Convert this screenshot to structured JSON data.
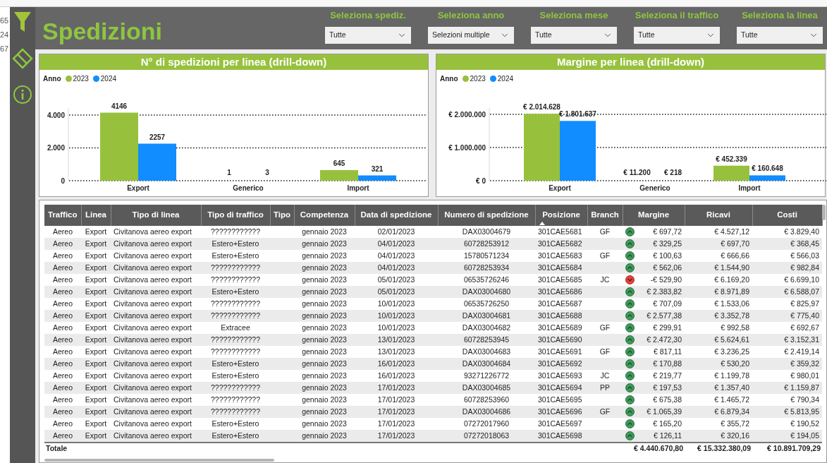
{
  "background_fragments": [
    "65",
    "24",
    "67"
  ],
  "title": "Spedizioni",
  "filters": [
    {
      "label": "Seleziona spediz.",
      "value": "Tutte"
    },
    {
      "label": "Seleziona anno",
      "value": "Selezioni multiple"
    },
    {
      "label": "Seleziona mese",
      "value": "Tutte"
    },
    {
      "label": "Seleziona il traffico",
      "value": "Tutte"
    },
    {
      "label": "Seleziona la linea",
      "value": "Tutte"
    }
  ],
  "charts": [
    {
      "title": "N° di spedizioni per linea (drill-down)",
      "legend_title": "Anno",
      "chart_data": {
        "type": "bar",
        "categories": [
          "Export",
          "Generico",
          "Import"
        ],
        "series": [
          {
            "name": "2023",
            "color": "#97c13c",
            "values": [
              4146,
              1,
              645
            ]
          },
          {
            "name": "2024",
            "color": "#118dff",
            "values": [
              2257,
              3,
              321
            ]
          }
        ],
        "ylim": [
          0,
          4400
        ],
        "yticks": [
          {
            "value": 0,
            "label": "0"
          },
          {
            "value": 2000,
            "label": "2.000"
          },
          {
            "value": 4000,
            "label": "4.000"
          }
        ],
        "value_labels": [
          [
            "4146",
            "1",
            "645"
          ],
          [
            "2257",
            "3",
            "321"
          ]
        ]
      }
    },
    {
      "title": "Margine per linea (drill-down)",
      "legend_title": "Anno",
      "chart_data": {
        "type": "bar",
        "categories": [
          "Export",
          "Generico",
          "Import"
        ],
        "series": [
          {
            "name": "2023",
            "color": "#97c13c",
            "values": [
              2014628,
              11200,
              452339
            ]
          },
          {
            "name": "2024",
            "color": "#118dff",
            "values": [
              1801637,
              218,
              160648
            ]
          }
        ],
        "ylim": [
          0,
          2200000
        ],
        "yticks": [
          {
            "value": 0,
            "label": "€ 0"
          },
          {
            "value": 1000000,
            "label": "€ 1.000.000"
          },
          {
            "value": 2000000,
            "label": "€ 2.000.000"
          }
        ],
        "value_labels": [
          [
            "€ 2.014.628",
            "€ 11.200",
            "€ 452.339"
          ],
          [
            "€ 1.801.637",
            "€ 218",
            "€ 160.648"
          ]
        ]
      }
    }
  ],
  "table": {
    "columns": [
      {
        "label": "Traffico",
        "sorted": false
      },
      {
        "label": "Linea",
        "sorted": false
      },
      {
        "label": "Tipo di linea",
        "sorted": false
      },
      {
        "label": "Tipo di traffico",
        "sorted": false
      },
      {
        "label": "Tipo",
        "sorted": false
      },
      {
        "label": "Competenza",
        "sorted": false
      },
      {
        "label": "Data di spedizione",
        "sorted": false
      },
      {
        "label": "Numero di spedizione",
        "sorted": false
      },
      {
        "label": "Posizione",
        "sorted": true
      },
      {
        "label": "Branch",
        "sorted": false
      },
      {
        "label": "Margine",
        "sorted": false
      },
      {
        "label": "Ricavi",
        "sorted": false
      },
      {
        "label": "Costi",
        "sorted": false
      }
    ],
    "rows": [
      {
        "traffico": "Aereo",
        "linea": "Export",
        "tipo_di_linea": "Civitanova aereo export",
        "tipo_di_traffico": "????????????",
        "competenza": "gennaio 2023",
        "data": "02/01/2023",
        "numero": "DAX03004679",
        "posizione": "301CAE5681",
        "branch": "GF",
        "margine": "€ 697,72",
        "ricavi": "€ 4.527,12",
        "costi": "€ 3.829,40",
        "positive": true
      },
      {
        "traffico": "Aereo",
        "linea": "Export",
        "tipo_di_linea": "Civitanova aereo export",
        "tipo_di_traffico": "Estero+Estero",
        "competenza": "gennaio 2023",
        "data": "04/01/2023",
        "numero": "60728253912",
        "posizione": "301CAE5682",
        "margine": "€ 329,25",
        "ricavi": "€ 697,70",
        "costi": "€ 368,45",
        "positive": true
      },
      {
        "traffico": "Aereo",
        "linea": "Export",
        "tipo_di_linea": "Civitanova aereo export",
        "tipo_di_traffico": "Estero+Estero",
        "competenza": "gennaio 2023",
        "data": "04/01/2023",
        "numero": "15780571234",
        "posizione": "301CAE5683",
        "branch": "GF",
        "margine": "€ 100,63",
        "ricavi": "€ 666,66",
        "costi": "€ 566,03",
        "positive": true
      },
      {
        "traffico": "Aereo",
        "linea": "Export",
        "tipo_di_linea": "Civitanova aereo export",
        "tipo_di_traffico": "????????????",
        "competenza": "gennaio 2023",
        "data": "04/01/2023",
        "numero": "60728253934",
        "posizione": "301CAE5684",
        "margine": "€ 562,06",
        "ricavi": "€ 1.544,90",
        "costi": "€ 982,84",
        "positive": true
      },
      {
        "traffico": "Aereo",
        "linea": "Export",
        "tipo_di_linea": "Civitanova aereo export",
        "tipo_di_traffico": "????????????",
        "competenza": "gennaio 2023",
        "data": "05/01/2023",
        "numero": "06535726246",
        "posizione": "301CAE5685",
        "branch": "JC",
        "margine": "-€ 529,90",
        "ricavi": "€ 6.169,20",
        "costi": "€ 6.699,10",
        "positive": false
      },
      {
        "traffico": "Aereo",
        "linea": "Export",
        "tipo_di_linea": "Civitanova aereo export",
        "tipo_di_traffico": "Estero+Estero",
        "competenza": "gennaio 2023",
        "data": "05/01/2023",
        "numero": "DAX03004680",
        "posizione": "301CAE5686",
        "margine": "€ 2.383,82",
        "ricavi": "€ 8.971,89",
        "costi": "€ 6.588,07",
        "positive": true
      },
      {
        "traffico": "Aereo",
        "linea": "Export",
        "tipo_di_linea": "Civitanova aereo export",
        "tipo_di_traffico": "????????????",
        "competenza": "gennaio 2023",
        "data": "10/01/2023",
        "numero": "06535726250",
        "posizione": "301CAE5687",
        "margine": "€ 707,09",
        "ricavi": "€ 1.533,06",
        "costi": "€ 825,97",
        "positive": true
      },
      {
        "traffico": "Aereo",
        "linea": "Export",
        "tipo_di_linea": "Civitanova aereo export",
        "tipo_di_traffico": "????????????",
        "competenza": "gennaio 2023",
        "data": "10/01/2023",
        "numero": "DAX03004681",
        "posizione": "301CAE5688",
        "margine": "€ 2.577,38",
        "ricavi": "€ 3.352,78",
        "costi": "€ 775,40",
        "positive": true
      },
      {
        "traffico": "Aereo",
        "linea": "Export",
        "tipo_di_linea": "Civitanova aereo export",
        "tipo_di_traffico": "Extracee",
        "competenza": "gennaio 2023",
        "data": "10/01/2023",
        "numero": "DAX03004682",
        "posizione": "301CAE5689",
        "branch": "GF",
        "margine": "€ 299,91",
        "ricavi": "€ 992,58",
        "costi": "€ 692,67",
        "positive": true
      },
      {
        "traffico": "Aereo",
        "linea": "Export",
        "tipo_di_linea": "Civitanova aereo export",
        "tipo_di_traffico": "????????????",
        "competenza": "gennaio 2023",
        "data": "13/01/2023",
        "numero": "60728253945",
        "posizione": "301CAE5690",
        "margine": "€ 2.472,30",
        "ricavi": "€ 5.624,61",
        "costi": "€ 3.152,31",
        "positive": true
      },
      {
        "traffico": "Aereo",
        "linea": "Export",
        "tipo_di_linea": "Civitanova aereo export",
        "tipo_di_traffico": "????????????",
        "competenza": "gennaio 2023",
        "data": "13/01/2023",
        "numero": "DAX03004683",
        "posizione": "301CAE5691",
        "branch": "GF",
        "margine": "€ 817,11",
        "ricavi": "€ 3.236,25",
        "costi": "€ 2.419,14",
        "positive": true
      },
      {
        "traffico": "Aereo",
        "linea": "Export",
        "tipo_di_linea": "Civitanova aereo export",
        "tipo_di_traffico": "Estero+Estero",
        "competenza": "gennaio 2023",
        "data": "16/01/2023",
        "numero": "DAX03004684",
        "posizione": "301CAE5692",
        "margine": "€ 170,88",
        "ricavi": "€ 530,20",
        "costi": "€ 359,32",
        "positive": true
      },
      {
        "traffico": "Aereo",
        "linea": "Export",
        "tipo_di_linea": "Civitanova aereo export",
        "tipo_di_traffico": "Estero+Estero",
        "competenza": "gennaio 2023",
        "data": "16/01/2023",
        "numero": "93271226772",
        "posizione": "301CAE5693",
        "branch": "JC",
        "margine": "€ 219,77",
        "ricavi": "€ 1.199,78",
        "costi": "€ 980,01",
        "positive": true
      },
      {
        "traffico": "Aereo",
        "linea": "Export",
        "tipo_di_linea": "Civitanova aereo export",
        "tipo_di_traffico": "????????????",
        "competenza": "gennaio 2023",
        "data": "17/01/2023",
        "numero": "DAX03004685",
        "posizione": "301CAE5694",
        "branch": "PP",
        "margine": "€ 197,53",
        "ricavi": "€ 1.357,40",
        "costi": "€ 1.159,87",
        "positive": true
      },
      {
        "traffico": "Aereo",
        "linea": "Export",
        "tipo_di_linea": "Civitanova aereo export",
        "tipo_di_traffico": "????????????",
        "competenza": "gennaio 2023",
        "data": "17/01/2023",
        "numero": "60728253960",
        "posizione": "301CAE5695",
        "margine": "€ 675,38",
        "ricavi": "€ 1.465,72",
        "costi": "€ 790,34",
        "positive": true
      },
      {
        "traffico": "Aereo",
        "linea": "Export",
        "tipo_di_linea": "Civitanova aereo export",
        "tipo_di_traffico": "????????????",
        "competenza": "gennaio 2023",
        "data": "17/01/2023",
        "numero": "DAX03004686",
        "posizione": "301CAE5696",
        "branch": "GF",
        "margine": "€ 1.065,39",
        "ricavi": "€ 6.879,34",
        "costi": "€ 5.813,95",
        "positive": true
      },
      {
        "traffico": "Aereo",
        "linea": "Export",
        "tipo_di_linea": "Civitanova aereo export",
        "tipo_di_traffico": "Estero+Estero",
        "competenza": "gennaio 2023",
        "data": "17/01/2023",
        "numero": "07272017960",
        "posizione": "301CAE5697",
        "margine": "€ 165,20",
        "ricavi": "€ 355,72",
        "costi": "€ 190,52",
        "positive": true
      },
      {
        "traffico": "Aereo",
        "linea": "Export",
        "tipo_di_linea": "Civitanova aereo export",
        "tipo_di_traffico": "Estero+Estero",
        "competenza": "gennaio 2023",
        "data": "17/01/2023",
        "numero": "07272018063",
        "posizione": "301CAE5698",
        "margine": "€ 126,11",
        "ricavi": "€ 320,16",
        "costi": "€ 194,05",
        "positive": true
      }
    ],
    "totals": {
      "label": "Totale",
      "margine": "€ 4.440.670,80",
      "ricavi": "€ 15.332.380,09",
      "costi": "€ 10.891.709,29"
    }
  }
}
